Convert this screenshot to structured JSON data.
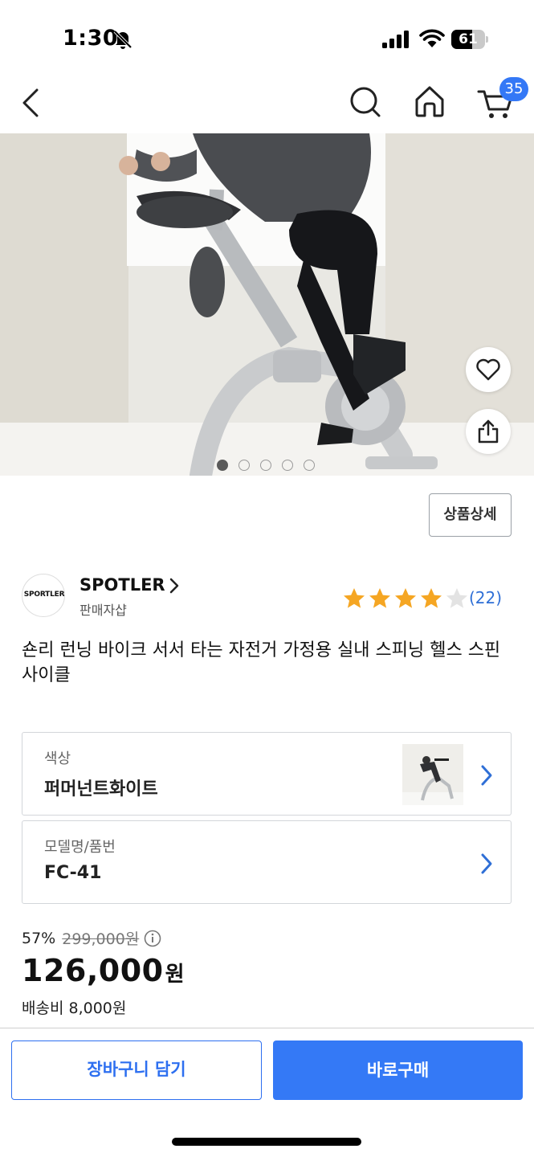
{
  "status_bar": {
    "time": "1:30",
    "battery": "61",
    "battery_level": 0.61
  },
  "header": {
    "icons": [
      "chevron-left-icon",
      "search-icon",
      "home-icon",
      "cart-icon"
    ],
    "cart_count": "35"
  },
  "gallery": {
    "image": "exercise-bike-photo",
    "page_count": 5,
    "active_index": 0
  },
  "detail_button": "상품상세",
  "seller": {
    "logo_text": "SPORTLER",
    "name": "SPOTLER",
    "sub_label": "판매자샵"
  },
  "rating": {
    "stars": 4,
    "max": 5,
    "count_text": "(22)"
  },
  "product": {
    "title": "숀리 런닝 바이크 서서 타는 자전거 가정용 실내 스피닝 헬스 스핀 사이클"
  },
  "options": {
    "color": {
      "label": "색상",
      "value": "퍼머넌트화이트"
    },
    "model": {
      "label": "모델명/품번",
      "value": "FC-41"
    }
  },
  "price": {
    "discount": "57%",
    "original": "299,000원",
    "current": "126,000",
    "unit": "원",
    "shipping": "배송비 8,000원"
  },
  "bottom_bar": {
    "cart_label": "장바구니 담기",
    "buy_label": "바로구매"
  },
  "colors": {
    "accent": "#3479f6",
    "star": "#f5a623",
    "star_empty": "#e3e3e3",
    "link": "#2f6fd6"
  }
}
